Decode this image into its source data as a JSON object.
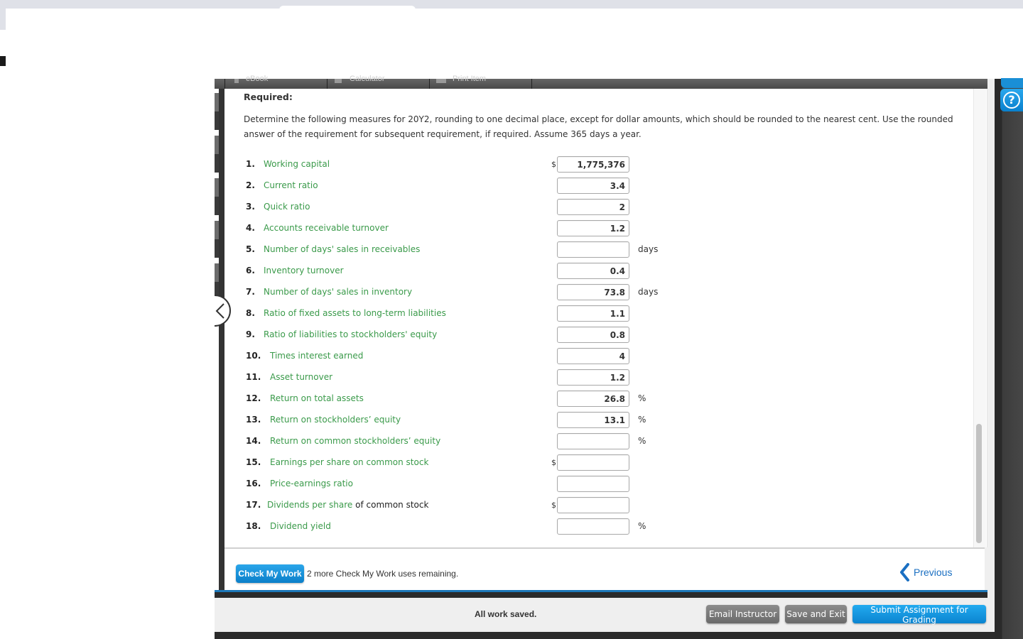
{
  "toolbar": {
    "items": [
      {
        "label": "eBook",
        "icon": "book-icon"
      },
      {
        "label": "Calculator",
        "icon": "calculator-icon"
      },
      {
        "label": "Print Item",
        "icon": "print-icon"
      }
    ]
  },
  "help": {
    "icon": "question-icon",
    "label": "?"
  },
  "question": {
    "required_label": "Required:",
    "instructions": "Determine the following measures for 20Y2, rounding to one decimal place, except for dollar amounts, which should be rounded to the nearest cent. Use the rounded answer of the requirement for subsequent requirement, if required. Assume 365 days a year."
  },
  "rows": [
    {
      "num": "1.",
      "label": "Working capital",
      "label_plain": "",
      "prefix": "$",
      "value": "1,775,376",
      "unit": ""
    },
    {
      "num": "2.",
      "label": "Current ratio",
      "label_plain": "",
      "prefix": "",
      "value": "3.4",
      "unit": ""
    },
    {
      "num": "3.",
      "label": "Quick ratio",
      "label_plain": "",
      "prefix": "",
      "value": "2",
      "unit": ""
    },
    {
      "num": "4.",
      "label": "Accounts receivable turnover",
      "label_plain": "",
      "prefix": "",
      "value": "1.2",
      "unit": ""
    },
    {
      "num": "5.",
      "label": "Number of days' sales in receivables",
      "label_plain": "",
      "prefix": "",
      "value": "",
      "unit": "days"
    },
    {
      "num": "6.",
      "label": "Inventory turnover",
      "label_plain": "",
      "prefix": "",
      "value": "0.4",
      "unit": ""
    },
    {
      "num": "7.",
      "label": "Number of days' sales in inventory",
      "label_plain": "",
      "prefix": "",
      "value": "73.8",
      "unit": "days"
    },
    {
      "num": "8.",
      "label": "Ratio of fixed assets to long-term liabilities",
      "label_plain": "",
      "prefix": "",
      "value": "1.1",
      "unit": ""
    },
    {
      "num": "9.",
      "label": "Ratio of liabilities to stockholders' equity",
      "label_plain": "",
      "prefix": "",
      "value": "0.8",
      "unit": ""
    },
    {
      "num": "10.",
      "label": "Times interest earned",
      "label_plain": "",
      "prefix": "",
      "value": "4",
      "unit": ""
    },
    {
      "num": "11.",
      "label": "Asset turnover",
      "label_plain": "",
      "prefix": "",
      "value": "1.2",
      "unit": ""
    },
    {
      "num": "12.",
      "label": "Return on total assets",
      "label_plain": "",
      "prefix": "",
      "value": "26.8",
      "unit": "%"
    },
    {
      "num": "13.",
      "label": "Return on stockholders’ equity",
      "label_plain": "",
      "prefix": "",
      "value": "13.1",
      "unit": "%"
    },
    {
      "num": "14.",
      "label": "Return on common stockholders’ equity",
      "label_plain": "",
      "prefix": "",
      "value": "",
      "unit": "%"
    },
    {
      "num": "15.",
      "label": "Earnings per share on common stock",
      "label_plain": "",
      "prefix": "$",
      "value": "",
      "unit": ""
    },
    {
      "num": "16.",
      "label": "Price-earnings ratio",
      "label_plain": "",
      "prefix": "",
      "value": "",
      "unit": ""
    },
    {
      "num": "17.",
      "label": "Dividends per share",
      "label_plain": " of common stock",
      "prefix": "$",
      "value": "",
      "unit": ""
    },
    {
      "num": "18.",
      "label": "Dividend yield",
      "label_plain": "",
      "prefix": "",
      "value": "",
      "unit": "%"
    }
  ],
  "footer": {
    "check_label": "Check My Work",
    "check_info": "2 more Check My Work uses remaining.",
    "previous_label": "Previous"
  },
  "status": {
    "saved_text": "All work saved.",
    "email_label": "Email Instructor",
    "save_exit_label": "Save and Exit",
    "submit_label": "Submit Assignment for Grading"
  },
  "colors": {
    "label_green": "#3a9a4a",
    "accent_blue": "#0b84d0",
    "link_blue": "#1a6fc2"
  }
}
